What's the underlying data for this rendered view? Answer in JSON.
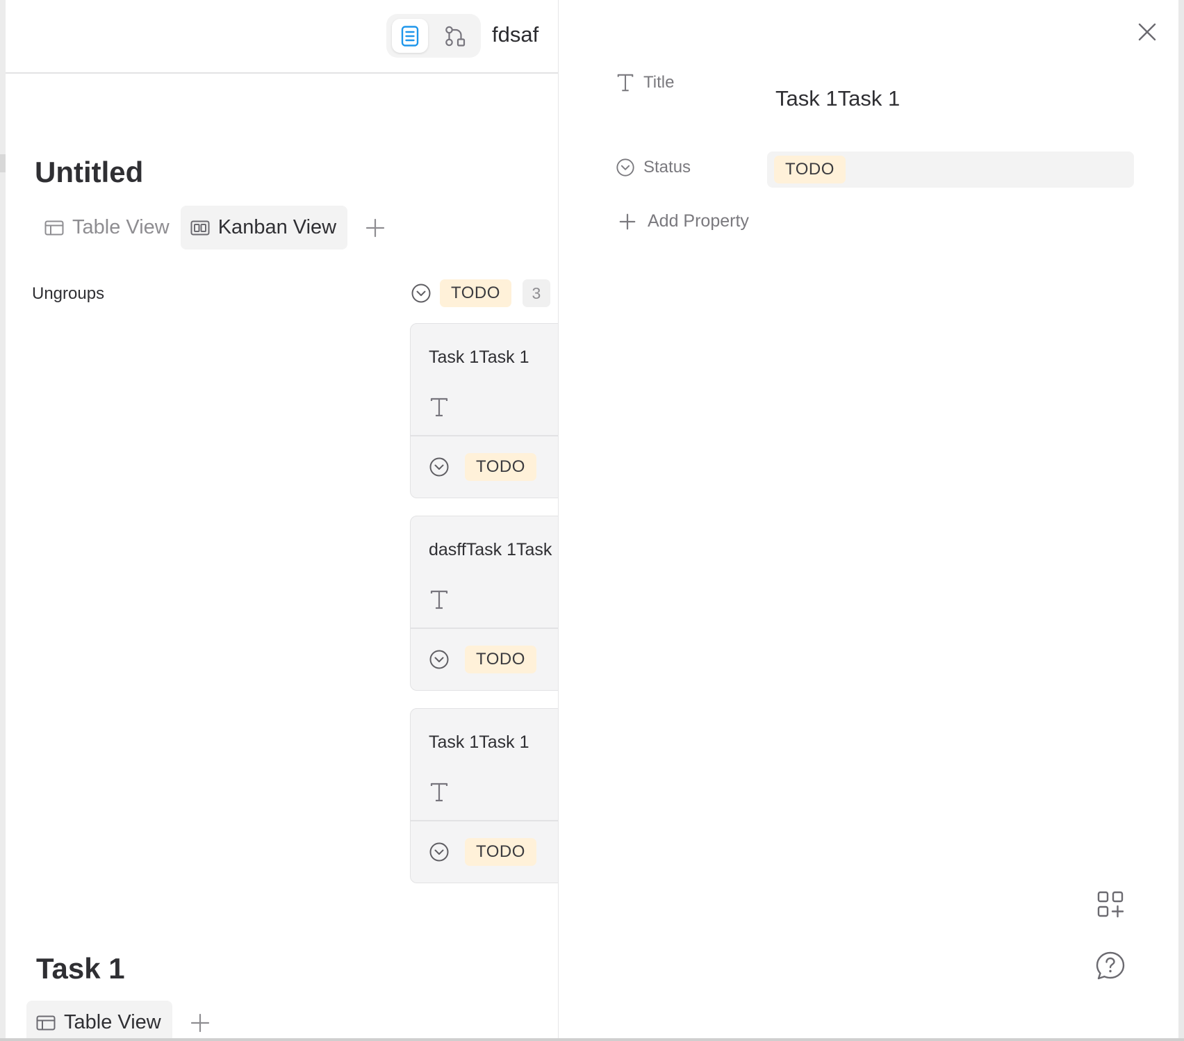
{
  "header": {
    "doc_name": "fdsaf",
    "page_mode_icon": "page-mode-icon",
    "edgeless_mode_icon": "edgeless-mode-icon"
  },
  "database": {
    "title": "Untitled",
    "views": [
      {
        "label": "Table View",
        "icon": "table-view-icon",
        "active": false
      },
      {
        "label": "Kanban View",
        "icon": "kanban-view-icon",
        "active": true
      }
    ],
    "ungroups_label": "Ungroups",
    "group": {
      "status": "TODO",
      "count": "3",
      "color": "#fff1d9"
    },
    "cards": [
      {
        "title": "Task 1Task 1",
        "status": "TODO"
      },
      {
        "title": "dasffTask 1Task",
        "status": "TODO"
      },
      {
        "title": "Task 1Task 1",
        "status": "TODO"
      }
    ]
  },
  "second_database": {
    "title": "Task 1",
    "views": [
      {
        "label": "Table View",
        "icon": "table-view-icon",
        "active": true
      }
    ]
  },
  "peek": {
    "title_label": "Title",
    "title_value": "Task 1Task 1",
    "status_label": "Status",
    "status_value": "TODO",
    "add_property_label": "Add Property"
  }
}
